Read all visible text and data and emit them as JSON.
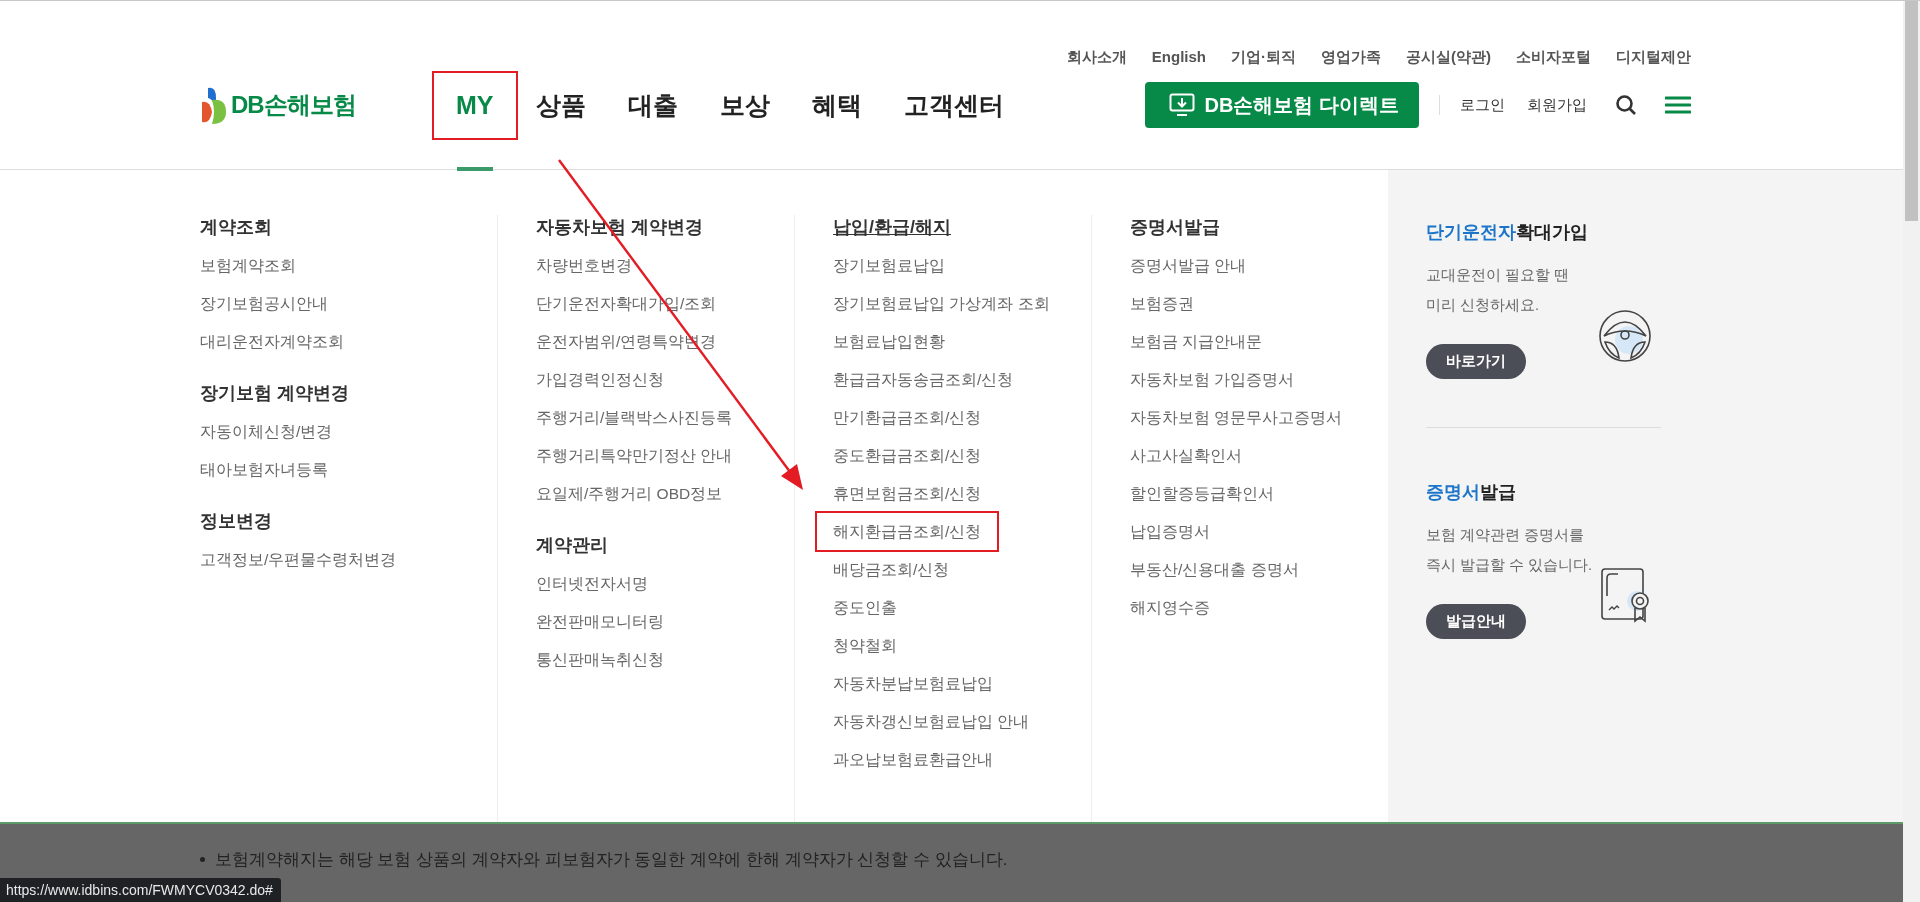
{
  "header": {
    "logo_text": "DB손해보험",
    "utility_links": [
      "회사소개",
      "English",
      "기업·퇴직",
      "영업가족",
      "공시실(약관)",
      "소비자포털",
      "디지털제안"
    ],
    "nav": [
      {
        "label": "MY",
        "selected": true,
        "highlighted": true
      },
      {
        "label": "상품",
        "selected": false,
        "highlighted": false
      },
      {
        "label": "대출",
        "selected": false,
        "highlighted": false
      },
      {
        "label": "보상",
        "selected": false,
        "highlighted": false
      },
      {
        "label": "혜택",
        "selected": false,
        "highlighted": false
      },
      {
        "label": "고객센터",
        "selected": false,
        "highlighted": false
      }
    ],
    "direct_button": "DB손해보험 다이렉트",
    "login": "로그인",
    "register": "회원가입"
  },
  "mega_menu": {
    "columns": [
      {
        "groups": [
          {
            "heading": "계약조회",
            "active": false,
            "items": [
              {
                "label": "보험계약조회",
                "highlighted": false
              },
              {
                "label": "장기보험공시안내",
                "highlighted": false
              },
              {
                "label": "대리운전자계약조회",
                "highlighted": false
              }
            ]
          },
          {
            "heading": "장기보험 계약변경",
            "active": false,
            "items": [
              {
                "label": "자동이체신청/변경",
                "highlighted": false
              },
              {
                "label": "태아보험자녀등록",
                "highlighted": false
              }
            ]
          },
          {
            "heading": "정보변경",
            "active": false,
            "items": [
              {
                "label": "고객정보/우편물수령처변경",
                "highlighted": false
              }
            ]
          }
        ]
      },
      {
        "groups": [
          {
            "heading": "자동차보험 계약변경",
            "active": false,
            "items": [
              {
                "label": "차량번호변경",
                "highlighted": false
              },
              {
                "label": "단기운전자확대가입/조회",
                "highlighted": false
              },
              {
                "label": "운전자범위/연령특약변경",
                "highlighted": false
              },
              {
                "label": "가입경력인정신청",
                "highlighted": false
              },
              {
                "label": "주행거리/블랙박스사진등록",
                "highlighted": false
              },
              {
                "label": "주행거리특약만기정산 안내",
                "highlighted": false
              },
              {
                "label": "요일제/주행거리 OBD정보",
                "highlighted": false
              }
            ]
          },
          {
            "heading": "계약관리",
            "active": false,
            "items": [
              {
                "label": "인터넷전자서명",
                "highlighted": false
              },
              {
                "label": "완전판매모니터링",
                "highlighted": false
              },
              {
                "label": "통신판매녹취신청",
                "highlighted": false
              }
            ]
          }
        ]
      },
      {
        "groups": [
          {
            "heading": "납입/환급/해지",
            "active": true,
            "items": [
              {
                "label": "장기보험료납입",
                "highlighted": false
              },
              {
                "label": "장기보험료납입 가상계좌 조회",
                "highlighted": false
              },
              {
                "label": "보험료납입현황",
                "highlighted": false
              },
              {
                "label": "환급금자동송금조회/신청",
                "highlighted": false
              },
              {
                "label": "만기환급금조회/신청",
                "highlighted": false
              },
              {
                "label": "중도환급금조회/신청",
                "highlighted": false
              },
              {
                "label": "휴면보험금조회/신청",
                "highlighted": false
              },
              {
                "label": "해지환급금조회/신청",
                "highlighted": true
              },
              {
                "label": "배당금조회/신청",
                "highlighted": false
              },
              {
                "label": "중도인출",
                "highlighted": false
              },
              {
                "label": "청약철회",
                "highlighted": false
              },
              {
                "label": "자동차분납보험료납입",
                "highlighted": false
              },
              {
                "label": "자동차갱신보험료납입 안내",
                "highlighted": false
              },
              {
                "label": "과오납보험료환급안내",
                "highlighted": false
              }
            ]
          }
        ]
      },
      {
        "groups": [
          {
            "heading": "증명서발급",
            "active": false,
            "items": [
              {
                "label": "증명서발급 안내",
                "highlighted": false
              },
              {
                "label": "보험증권",
                "highlighted": false
              },
              {
                "label": "보험금 지급안내문",
                "highlighted": false
              },
              {
                "label": "자동차보험 가입증명서",
                "highlighted": false
              },
              {
                "label": "자동차보험 영문무사고증명서",
                "highlighted": false
              },
              {
                "label": "사고사실확인서",
                "highlighted": false
              },
              {
                "label": "할인할증등급확인서",
                "highlighted": false
              },
              {
                "label": "납입증명서",
                "highlighted": false
              },
              {
                "label": "부동산/신용대출 증명서",
                "highlighted": false
              },
              {
                "label": "해지영수증",
                "highlighted": false
              }
            ]
          }
        ]
      }
    ],
    "promos": [
      {
        "kind": "wheel",
        "title_highlight": "단기운전자",
        "title_rest": "확대가입",
        "description_lines": [
          "교대운전이 필요할 땐",
          "미리 신청하세요."
        ],
        "button": "바로가기"
      },
      {
        "kind": "certificate",
        "title_highlight": "증명서",
        "title_rest": "발급",
        "description_lines": [
          "보험 계약관련 증명서를",
          "즉시 발급할 수 있습니다."
        ],
        "button": "발급안내"
      }
    ]
  },
  "background_notice": "보험계약해지는 해당 보험 상품의 계약자와 피보험자가 동일한 계약에 한해 계약자가 신청할 수 있습니다.",
  "status_url": "https://www.idbins.com/FWMYCV0342.do#"
}
